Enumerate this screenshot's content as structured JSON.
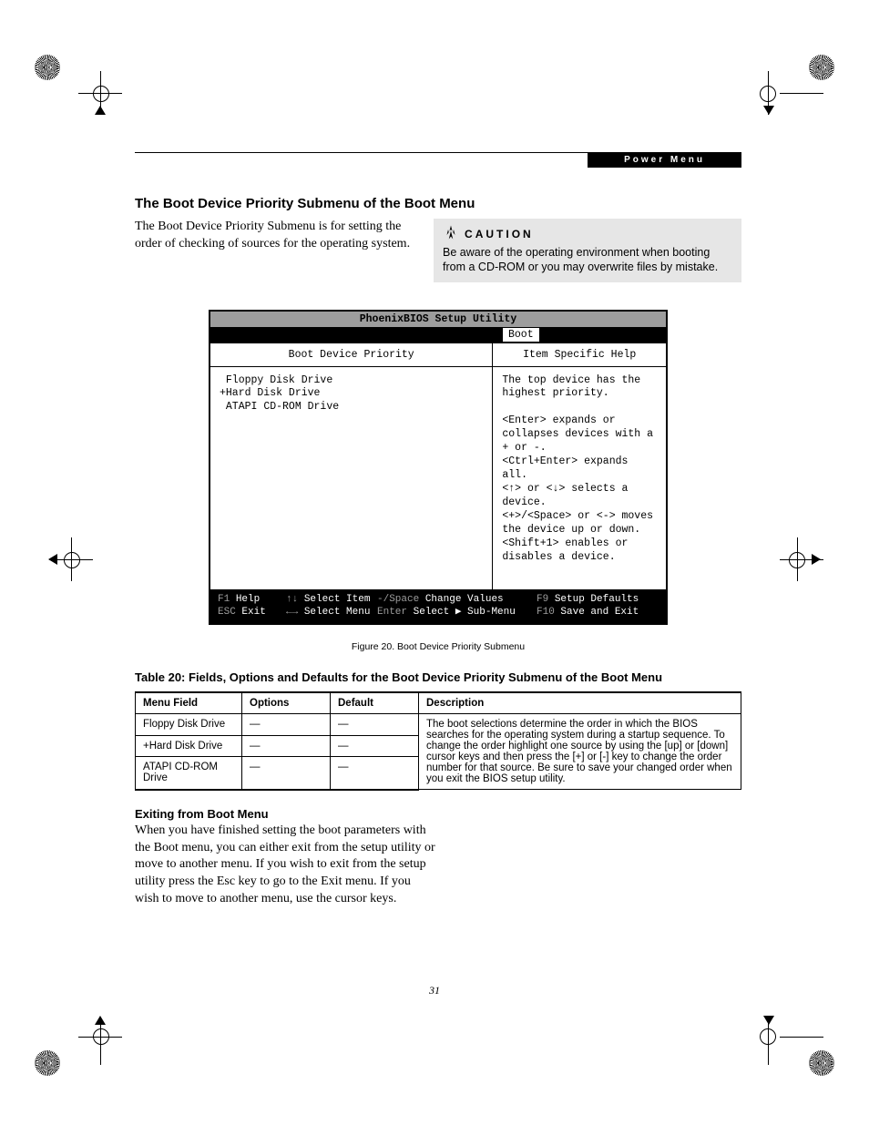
{
  "header": {
    "tag": "Power Menu"
  },
  "section": {
    "title": "The Boot Device Priority Submenu of the Boot Menu",
    "intro": "The Boot Device Priority Submenu is for setting the order of checking of sources for the operating system."
  },
  "caution": {
    "label": "CAUTION",
    "body": "Be aware of the operating environment when booting from a CD-ROM or you may overwrite files by mistake."
  },
  "bios": {
    "title": "PhoenixBIOS Setup Utility",
    "tab": "Boot",
    "left_title": "Boot Device Priority",
    "right_title": "Item Specific Help",
    "devices": " Floppy Disk Drive\n+Hard Disk Drive\n ATAPI CD-ROM Drive",
    "help": "The top device has the highest priority.\n\n<Enter> expands or collapses devices with a + or -.\n<Ctrl+Enter> expands all.\n<↑> or <↓> selects a device.\n<+>/<Space> or <-> moves the device up or down.\n<Shift+1> enables or disables a device.",
    "footer": {
      "r1": {
        "k1": "F1",
        "v1": "Help",
        "k2": "↑↓",
        "v2": "Select Item",
        "k3": "-/Space",
        "v3": "Change Values",
        "k4": "F9",
        "v4": "Setup Defaults"
      },
      "r2": {
        "k1": "ESC",
        "v1": "Exit",
        "k2": "←→",
        "v2": "Select Menu",
        "k3": "Enter",
        "v3": "Select ▶ Sub-Menu",
        "k4": "F10",
        "v4": "Save and Exit"
      }
    }
  },
  "figure_caption": "Figure 20.   Boot Device Priority Submenu",
  "table": {
    "title": "Table 20: Fields, Options and Defaults for the Boot Device Priority Submenu of the Boot Menu",
    "headers": {
      "c1": "Menu Field",
      "c2": "Options",
      "c3": "Default",
      "c4": "Description"
    },
    "rows": [
      {
        "c1": "Floppy Disk Drive",
        "c2": "—",
        "c3": "—"
      },
      {
        "c1": "+Hard Disk Drive",
        "c2": "—",
        "c3": "—"
      },
      {
        "c1": "ATAPI CD-ROM Drive",
        "c2": "—",
        "c3": "—"
      }
    ],
    "description": "The boot selections determine the order in which the BIOS searches for the operating system during a startup sequence. To change the order highlight one source by using the [up] or [down] cursor keys and then press the [+] or [-] key to change the order number for that source. Be sure to save your changed order when you exit the BIOS setup utility."
  },
  "exit": {
    "title": "Exiting from Boot Menu",
    "body": "When you have finished setting the boot parameters with the Boot menu, you can either exit from the setup utility or move to another menu. If you wish to exit from the setup utility press the Esc key to go to the Exit menu. If you wish to move to another menu, use the cursor keys."
  },
  "page_number": "31"
}
